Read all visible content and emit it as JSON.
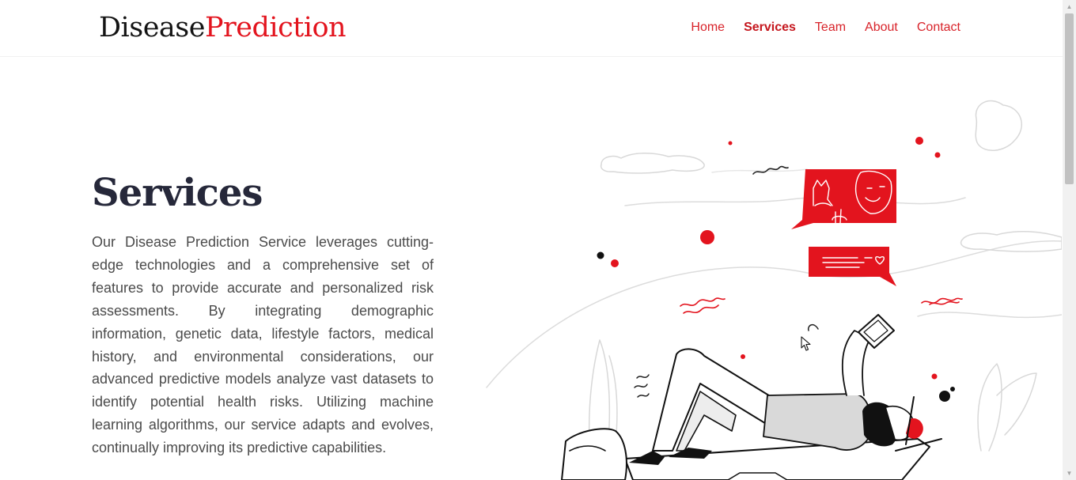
{
  "brand": {
    "part1": "Disease",
    "part2": "Prediction"
  },
  "nav": {
    "home": "Home",
    "services": "Services",
    "team": "Team",
    "about": "About",
    "contact": "Contact"
  },
  "services": {
    "title": "Services",
    "description": "Our Disease Prediction Service leverages cutting-edge technologies and a comprehensive set of features to provide accurate and personalized risk assessments. By integrating demographic information, genetic data, lifestyle factors, medical history, and environmental considerations, our advanced predictive models analyze vast datasets to identify potential health risks. Utilizing machine learning algorithms, our service adapts and evolves, continually improving its predictive capabilities."
  },
  "colors": {
    "accent": "#e3141e",
    "heading": "#26283a",
    "text": "#4b4b4b"
  },
  "icons": {
    "scroll_up": "triangle-up-icon",
    "scroll_down": "triangle-down-icon",
    "cursor": "arrow-cursor-icon"
  }
}
